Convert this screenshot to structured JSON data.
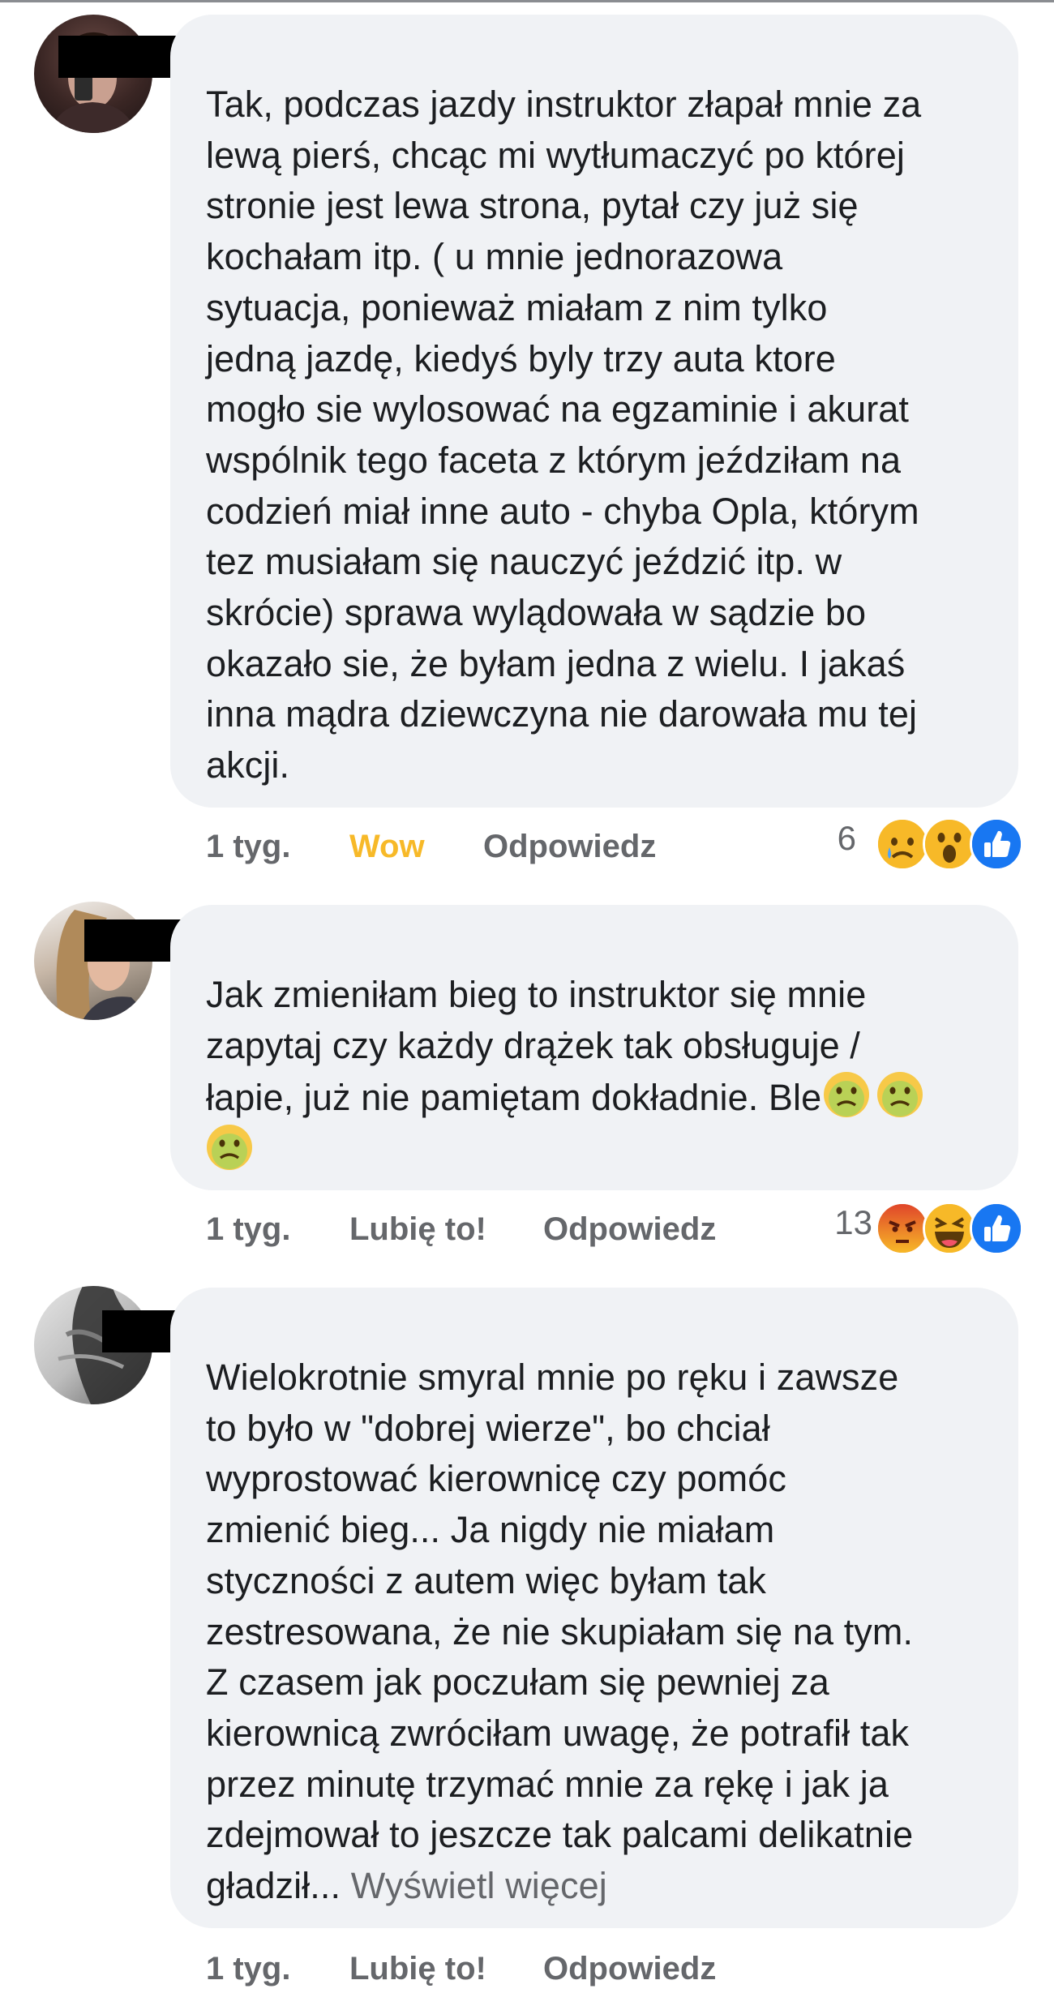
{
  "comments": [
    {
      "text": "Tak, podczas jazdy instruktor złapał mnie za\nlewą pierś, chcąc mi wytłumaczyć po której\nstronie jest lewa strona, pytał czy już się\nkochałam itp.  ( u mnie jednorazowa\nsytuacja, ponieważ miałam z nim tylko\njedną jazdę, kiedyś byly trzy auta ktore\nmogło sie wylosować na egzaminie i akurat\nwspólnik tego faceta z którym jeździłam na\ncodzień miał inne auto - chyba Opla, którym\ntez musiałam się nauczyć jeździć itp. w\nskrócie) sprawa wylądowała w sądzie bo\nokazało sie, że byłam jedna z wielu. I jakaś\ninna mądra dziewczyna nie darowała mu tej\nakcji.",
      "time": "1 tyg.",
      "reaction_label": "Wow",
      "reply_label": "Odpowiedz",
      "reaction_count": "6",
      "reaction_icons": [
        "sad-icon",
        "wow-icon",
        "like-icon"
      ]
    },
    {
      "text": "Jak zmieniłam bieg to instruktor się mnie\nzapytaj czy każdy drążek tak obsługuje /\nłapie, już nie pamiętam dokładnie. Ble",
      "inline_emojis": [
        "nauseated-face-icon",
        "nauseated-face-icon",
        "nauseated-face-icon"
      ],
      "time": "1 tyg.",
      "reaction_label": "Lubię to!",
      "reply_label": "Odpowiedz",
      "reaction_count": "13",
      "reaction_icons": [
        "angry-icon",
        "haha-icon",
        "like-icon"
      ]
    },
    {
      "text": "Wielokrotnie smyral mnie po ręku i zawsze\nto było w \"dobrej wierze\", bo chciał\nwyprostować kierownicę czy pomóc\nzmienić bieg... Ja nigdy nie miałam\nstyczności z autem więc byłam tak\nzestresowana, że nie skupiałam się na tym.\nZ czasem jak poczułam się pewniej za\nkierownicą zwróciłam uwagę, że potrafił tak\nprzez minutę trzymać mnie za rękę i jak ja\nzdejmował to jeszcze tak palcami delikatnie\ngładził...",
      "see_more": "Wyświetl więcej",
      "time": "1 tyg.",
      "reaction_label": "Lubię to!",
      "reply_label": "Odpowiedz"
    }
  ],
  "colors": {
    "bubble_bg": "#f0f2f5",
    "text": "#1c1e21",
    "secondary": "#65676b",
    "wow_active": "#f7b928",
    "like_blue": "#1877f2"
  }
}
